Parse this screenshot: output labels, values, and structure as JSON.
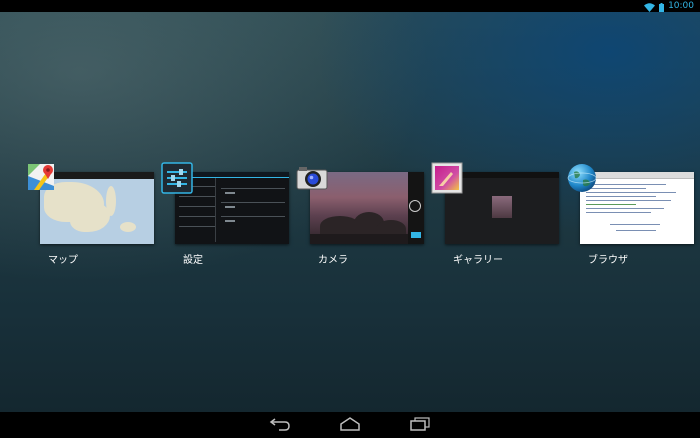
{
  "status_bar": {
    "time": "10:00",
    "icons": [
      "wifi-icon",
      "battery-icon"
    ]
  },
  "recent_apps": [
    {
      "label": "マップ",
      "icon": "maps-icon"
    },
    {
      "label": "設定",
      "icon": "settings-icon"
    },
    {
      "label": "カメラ",
      "icon": "camera-icon"
    },
    {
      "label": "ギャラリー",
      "icon": "gallery-icon"
    },
    {
      "label": "ブラウザ",
      "icon": "browser-icon"
    }
  ],
  "nav_bar": {
    "buttons": [
      "back-icon",
      "home-icon",
      "recents-icon"
    ]
  },
  "colors": {
    "accent": "#33b5e5",
    "status_bar": "#000000",
    "nav_bar": "#000000"
  }
}
